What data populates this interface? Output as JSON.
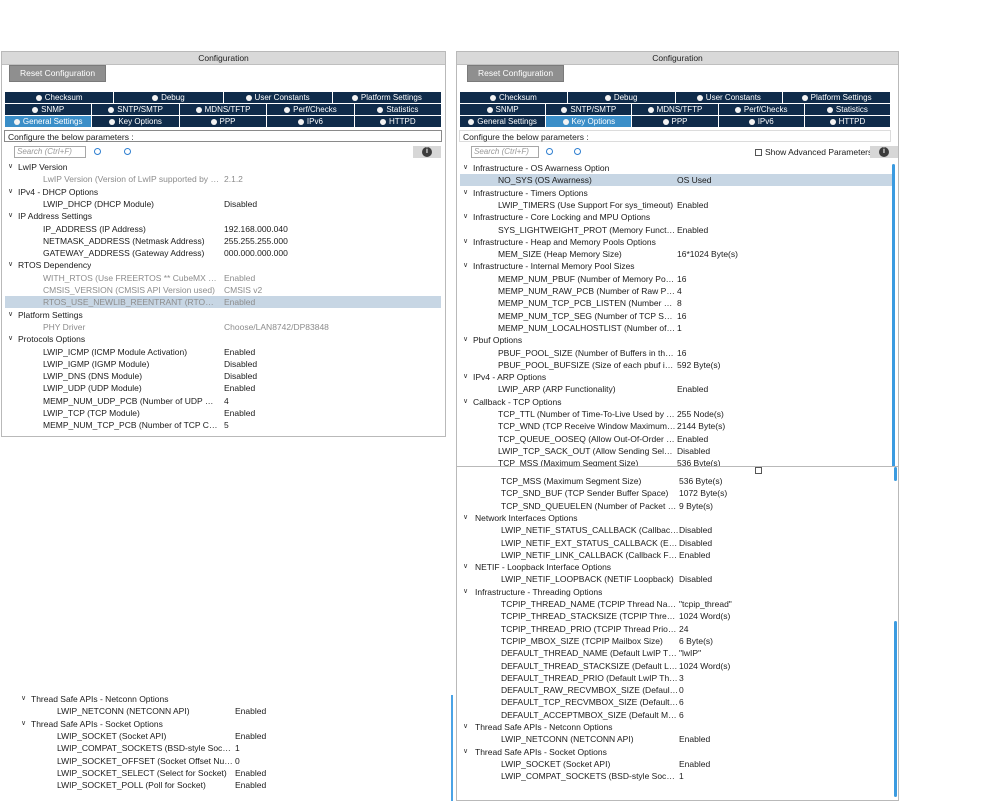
{
  "common": {
    "title": "Configuration",
    "reset": "Reset Configuration",
    "tabs_row1": [
      "Checksum",
      "Debug",
      "User Constants",
      "Platform Settings"
    ],
    "tabs_row2": [
      "SNMP",
      "SNTP/SMTP",
      "MDNS/TFTP",
      "Perf/Checks",
      "Statistics"
    ],
    "tabs_row3": [
      "General Settings",
      "Key Options",
      "PPP",
      "IPv6",
      "HTTPD"
    ],
    "configure": "Configure the below parameters :",
    "search_placeholder": "Search (Ctrl+F)",
    "info": "i",
    "show_advanced": "Show Advanced Parameters"
  },
  "left": {
    "rows": [
      {
        "t": "g",
        "label": "LwIP Version"
      },
      {
        "t": "p",
        "name": "LwIP Version (Version of LwIP supported by Cu...",
        "value": "2.1.2",
        "dim": true
      },
      {
        "t": "g",
        "label": "IPv4 - DHCP Options"
      },
      {
        "t": "p",
        "name": "LWIP_DHCP (DHCP Module)",
        "value": "Disabled"
      },
      {
        "t": "g",
        "label": "IP Address Settings"
      },
      {
        "t": "p",
        "name": "IP_ADDRESS (IP Address)",
        "value": "192.168.000.040"
      },
      {
        "t": "p",
        "name": "NETMASK_ADDRESS (Netmask Address)",
        "value": "255.255.255.000"
      },
      {
        "t": "p",
        "name": "GATEWAY_ADDRESS (Gateway Address)",
        "value": "000.000.000.000"
      },
      {
        "t": "g",
        "label": "RTOS Dependency"
      },
      {
        "t": "p",
        "name": "WITH_RTOS (Use FREERTOS ** CubeMX spec...",
        "value": "Enabled",
        "dim": true
      },
      {
        "t": "p",
        "name": "CMSIS_VERSION (CMSIS API Version used)",
        "value": "CMSIS v2",
        "dim": true
      },
      {
        "t": "p",
        "name": "RTOS_USE_NEWLIB_REENTRANT (RTOS use...",
        "value": "Enabled",
        "dim": true,
        "sel": true
      },
      {
        "t": "g",
        "label": "Platform Settings"
      },
      {
        "t": "p",
        "name": "PHY Driver",
        "value": "Choose/LAN8742/DP83848",
        "dim": true
      },
      {
        "t": "g",
        "label": "Protocols Options"
      },
      {
        "t": "p",
        "name": "LWIP_ICMP (ICMP Module Activation)",
        "value": "Enabled"
      },
      {
        "t": "p",
        "name": "LWIP_IGMP (IGMP Module)",
        "value": "Disabled"
      },
      {
        "t": "p",
        "name": "LWIP_DNS (DNS Module)",
        "value": "Disabled"
      },
      {
        "t": "p",
        "name": "LWIP_UDP (UDP Module)",
        "value": "Enabled"
      },
      {
        "t": "p",
        "name": "MEMP_NUM_UDP_PCB (Number of UDP Conn...",
        "value": "4"
      },
      {
        "t": "p",
        "name": "LWIP_TCP (TCP Module)",
        "value": "Enabled"
      },
      {
        "t": "p",
        "name": "MEMP_NUM_TCP_PCB (Number of TCP Conne...",
        "value": "5"
      }
    ],
    "bottom_rows": [
      {
        "t": "g",
        "label": "Thread Safe APIs - Netconn Options"
      },
      {
        "t": "p",
        "name": "LWIP_NETCONN (NETCONN API)",
        "value": "Enabled"
      },
      {
        "t": "g",
        "label": "Thread Safe APIs - Socket Options"
      },
      {
        "t": "p",
        "name": "LWIP_SOCKET (Socket API)",
        "value": "Enabled"
      },
      {
        "t": "p",
        "name": "LWIP_COMPAT_SOCKETS (BSD-style Socket...",
        "value": "1"
      },
      {
        "t": "p",
        "name": "LWIP_SOCKET_OFFSET (Socket Offset Numb...",
        "value": "0"
      },
      {
        "t": "p",
        "name": "LWIP_SOCKET_SELECT (Select for Socket)",
        "value": "Enabled"
      },
      {
        "t": "p",
        "name": "LWIP_SOCKET_POLL (Poll for Socket)",
        "value": "Enabled"
      }
    ]
  },
  "right": {
    "rows": [
      {
        "t": "g",
        "label": "Infrastructure - OS Awarness Option"
      },
      {
        "t": "p",
        "name": "NO_SYS (OS Awarness)",
        "value": "OS Used",
        "sel": true
      },
      {
        "t": "g",
        "label": "Infrastructure - Timers Options"
      },
      {
        "t": "p",
        "name": "LWIP_TIMERS (Use Support For sys_timeout)",
        "value": "Enabled"
      },
      {
        "t": "g",
        "label": "Infrastructure - Core Locking and MPU Options"
      },
      {
        "t": "p",
        "name": "SYS_LIGHTWEIGHT_PROT (Memory Function...",
        "value": "Enabled"
      },
      {
        "t": "g",
        "label": "Infrastructure - Heap and Memory Pools Options"
      },
      {
        "t": "p",
        "name": "MEM_SIZE (Heap Memory Size)",
        "value": "16*1024 Byte(s)"
      },
      {
        "t": "g",
        "label": "Infrastructure - Internal Memory Pool Sizes"
      },
      {
        "t": "p",
        "name": "MEMP_NUM_PBUF (Number of Memory Pool ...",
        "value": "16"
      },
      {
        "t": "p",
        "name": "MEMP_NUM_RAW_PCB (Number of Raw Prot...",
        "value": "4"
      },
      {
        "t": "p",
        "name": "MEMP_NUM_TCP_PCB_LISTEN (Number of Li...",
        "value": "8"
      },
      {
        "t": "p",
        "name": "MEMP_NUM_TCP_SEG (Number of TCP Seg...",
        "value": "16"
      },
      {
        "t": "p",
        "name": "MEMP_NUM_LOCALHOSTLIST (Number of Ho...",
        "value": "1"
      },
      {
        "t": "g",
        "label": "Pbuf Options"
      },
      {
        "t": "p",
        "name": "PBUF_POOL_SIZE (Number of Buffers in the P...",
        "value": "16"
      },
      {
        "t": "p",
        "name": "PBUF_POOL_BUFSIZE (Size of each pbuf in t...",
        "value": "592 Byte(s)"
      },
      {
        "t": "g",
        "label": "IPv4 - ARP Options"
      },
      {
        "t": "p",
        "name": "LWIP_ARP (ARP Functionality)",
        "value": "Enabled"
      },
      {
        "t": "g",
        "label": "Callback - TCP Options"
      },
      {
        "t": "p",
        "name": "TCP_TTL (Number of Time-To-Live Used by TC...",
        "value": "255 Node(s)"
      },
      {
        "t": "p",
        "name": "TCP_WND (TCP Receive Window Maximum Si...",
        "value": "2144 Byte(s)"
      },
      {
        "t": "p",
        "name": "TCP_QUEUE_OOSEQ (Allow Out-Of-Order Inc...",
        "value": "Enabled"
      },
      {
        "t": "p",
        "name": "LWIP_TCP_SACK_OUT (Allow Sending Selecti...",
        "value": "Disabled"
      },
      {
        "t": "p",
        "name": "TCP_MSS (Maximum Segment Size)",
        "value": "536 Byte(s)"
      }
    ],
    "bottom_rows": [
      {
        "t": "p",
        "name": "TCP_MSS (Maximum Segment Size)",
        "value": "536 Byte(s)"
      },
      {
        "t": "p",
        "name": "TCP_SND_BUF (TCP Sender Buffer Space)",
        "value": "1072 Byte(s)"
      },
      {
        "t": "p",
        "name": "TCP_SND_QUEUELEN (Number of Packet Buff...",
        "value": "9 Byte(s)"
      },
      {
        "t": "g",
        "label": "Network Interfaces Options"
      },
      {
        "t": "p",
        "name": "LWIP_NETIF_STATUS_CALLBACK (Callback ...",
        "value": "Disabled"
      },
      {
        "t": "p",
        "name": "LWIP_NETIF_EXT_STATUS_CALLBACK (Exte...",
        "value": "Disabled"
      },
      {
        "t": "p",
        "name": "LWIP_NETIF_LINK_CALLBACK (Callback Fun...",
        "value": "Enabled"
      },
      {
        "t": "g",
        "label": "NETIF - Loopback Interface Options"
      },
      {
        "t": "p",
        "name": "LWIP_NETIF_LOOPBACK (NETIF Loopback)",
        "value": "Disabled"
      },
      {
        "t": "g",
        "label": "Infrastructure - Threading Options"
      },
      {
        "t": "p",
        "name": "TCPIP_THREAD_NAME (TCPIP Thread Name)",
        "value": "\"tcpip_thread\""
      },
      {
        "t": "p",
        "name": "TCPIP_THREAD_STACKSIZE (TCPIP Thread S...",
        "value": "1024 Word(s)"
      },
      {
        "t": "p",
        "name": "TCPIP_THREAD_PRIO (TCPIP Thread Priority ...",
        "value": "24"
      },
      {
        "t": "p",
        "name": "TCPIP_MBOX_SIZE (TCPIP Mailbox Size)",
        "value": "6 Byte(s)"
      },
      {
        "t": "p",
        "name": "DEFAULT_THREAD_NAME (Default LwIP Thre...",
        "value": "\"lwIP\""
      },
      {
        "t": "p",
        "name": "DEFAULT_THREAD_STACKSIZE (Default LwIP...",
        "value": "1024 Word(s)"
      },
      {
        "t": "p",
        "name": "DEFAULT_THREAD_PRIO (Default LwIP Threa...",
        "value": "3"
      },
      {
        "t": "p",
        "name": "DEFAULT_RAW_RECVMBOX_SIZE (Default M...",
        "value": "0"
      },
      {
        "t": "p",
        "name": "DEFAULT_TCP_RECVMBOX_SIZE (Default Ma...",
        "value": "6"
      },
      {
        "t": "p",
        "name": "DEFAULT_ACCEPTMBOX_SIZE (Default Mailb...",
        "value": "6"
      },
      {
        "t": "g",
        "label": "Thread Safe APIs - Netconn Options"
      },
      {
        "t": "p",
        "name": "LWIP_NETCONN (NETCONN API)",
        "value": "Enabled"
      },
      {
        "t": "g",
        "label": "Thread Safe APIs - Socket Options"
      },
      {
        "t": "p",
        "name": "LWIP_SOCKET (Socket API)",
        "value": "Enabled"
      },
      {
        "t": "p",
        "name": "LWIP_COMPAT_SOCKETS (BSD-style Socket...",
        "value": "1"
      }
    ]
  }
}
